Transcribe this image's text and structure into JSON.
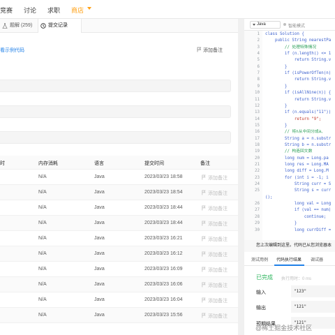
{
  "nav": {
    "items": [
      "竞赛",
      "讨论",
      "求职"
    ],
    "shop": "商店"
  },
  "tabs": {
    "solutions": "题解 (259)",
    "submissions": "提交记录"
  },
  "panel": {
    "demo_link": "看示例代码",
    "add_note": "添加备注"
  },
  "table": {
    "headers": [
      "时",
      "内存消耗",
      "语言",
      "提交时间",
      "备注"
    ],
    "rows": [
      {
        "memory": "N/A",
        "language": "Java",
        "time": "2023/03/23 18:58",
        "note": "添加备注"
      },
      {
        "memory": "N/A",
        "language": "Java",
        "time": "2023/03/23 18:54",
        "note": "添加备注"
      },
      {
        "memory": "N/A",
        "language": "Java",
        "time": "2023/03/23 18:44",
        "note": "添加备注"
      },
      {
        "memory": "N/A",
        "language": "Java",
        "time": "2023/03/23 18:44",
        "note": "添加备注"
      },
      {
        "memory": "N/A",
        "language": "Java",
        "time": "2023/03/23 16:21",
        "note": "添加备注"
      },
      {
        "memory": "N/A",
        "language": "Java",
        "time": "2023/03/23 16:12",
        "note": "添加备注"
      },
      {
        "memory": "N/A",
        "language": "Java",
        "time": "2023/03/23 16:09",
        "note": "添加备注"
      },
      {
        "memory": "N/A",
        "language": "Java",
        "time": "2023/03/23 16:06",
        "note": "添加备注"
      },
      {
        "memory": "N/A",
        "language": "Java",
        "time": "2023/03/23 16:04",
        "note": "添加备注"
      },
      {
        "memory": "N/A",
        "language": "Java",
        "time": "2023/03/23 15:56",
        "note": "添加备注"
      }
    ]
  },
  "editor": {
    "language": "Java",
    "mode": "智能模式",
    "lines": [
      {
        "n": "1",
        "code": "class Solution {"
      },
      {
        "n": "2",
        "code": "    public String nearestPa"
      },
      {
        "n": "3",
        "code": "        // 处理特殊情况"
      },
      {
        "n": "4",
        "code": "        if (n.length() <= 1"
      },
      {
        "n": "5",
        "code": "            return String.v"
      },
      {
        "n": "6",
        "code": "        }"
      },
      {
        "n": "7",
        "code": "        if (isPowerOfTen(n)"
      },
      {
        "n": "8",
        "code": "            return String.v"
      },
      {
        "n": "9",
        "code": "        }"
      },
      {
        "n": "10",
        "code": "        if (isAllNine(n)) {"
      },
      {
        "n": "11",
        "code": "            return String.v"
      },
      {
        "n": "12",
        "code": "        }"
      },
      {
        "n": "13",
        "code": "        if (n.equals(\"11\"))"
      },
      {
        "n": "14",
        "code": "            return \"9\";"
      },
      {
        "n": "15",
        "code": "        }"
      },
      {
        "n": "16",
        "code": "        // 将n从中间分成a、"
      },
      {
        "n": "17",
        "code": "        String a = n.substr"
      },
      {
        "n": "18",
        "code": "        String b = n.substr"
      },
      {
        "n": "19",
        "code": "        // 构造回文数"
      },
      {
        "n": "20",
        "code": "        long num = Long.pa"
      },
      {
        "n": "21",
        "code": "        long res = Long.MA"
      },
      {
        "n": "22",
        "code": "        long diff = Long.M"
      },
      {
        "n": "23",
        "code": "        for (int i = -1; i"
      },
      {
        "n": "24",
        "code": "            String curr = S"
      },
      {
        "n": "25",
        "code": "            String s = curr"
      },
      {
        "n": "",
        "code": "();"
      },
      {
        "n": "26",
        "code": "            long val = Long"
      },
      {
        "n": "27",
        "code": "            if (val == num)"
      },
      {
        "n": "28",
        "code": "                continue;"
      },
      {
        "n": "29",
        "code": "            }"
      },
      {
        "n": "30",
        "code": "            long currDiff ="
      }
    ]
  },
  "hint": "您上次编辑到这里。代码已从您浏览器本",
  "result_tabs": [
    "测试用例",
    "代码执行结果",
    "调试器"
  ],
  "result": {
    "status": "已完成",
    "exec_time": "执行用时：0 ms",
    "input_label": "输入",
    "input_value": "\"123\"",
    "output_label": "输出",
    "output_value": "\"121\"",
    "expected_label": "预期结果",
    "expected_value": "\"121\""
  },
  "watermark": "@稀土掘金技术社区",
  "colors": {
    "accent": "#ffa116",
    "success": "#2db55d",
    "link": "#2080e8"
  }
}
